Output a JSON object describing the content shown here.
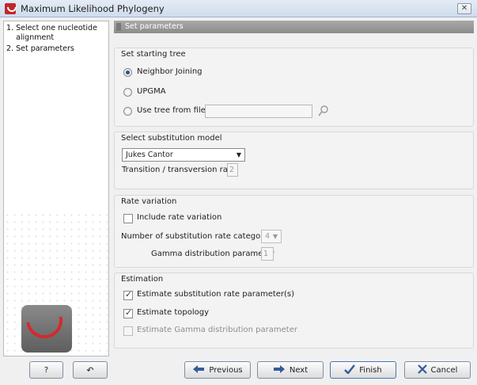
{
  "window": {
    "title": "Maximum Likelihood Phylogeny",
    "close_glyph": "✕"
  },
  "steps": [
    {
      "label": "1. Select one nucleotide\n    alignment"
    },
    {
      "label": "2. Set parameters"
    }
  ],
  "header": {
    "label": "Set parameters"
  },
  "starting_tree": {
    "title": "Set starting tree",
    "options": [
      {
        "label": "Neighbor Joining",
        "checked": true
      },
      {
        "label": "UPGMA",
        "checked": false
      },
      {
        "label": "Use tree from file",
        "checked": false
      }
    ],
    "file_value": ""
  },
  "substitution": {
    "title": "Select substitution model",
    "model": "Jukes Cantor",
    "ratio_label": "Transition / transversion ratio",
    "ratio_value": "2"
  },
  "rate_variation": {
    "title": "Rate variation",
    "include_label": "Include rate variation",
    "categories_label": "Number of substitution rate categories",
    "categories_value": "4",
    "gamma_label": "Gamma distribution parameter",
    "gamma_value": "1"
  },
  "estimation": {
    "title": "Estimation",
    "options": [
      {
        "label": "Estimate substitution rate parameter(s)",
        "checked": true,
        "enabled": true
      },
      {
        "label": "Estimate topology",
        "checked": true,
        "enabled": true
      },
      {
        "label": "Estimate Gamma distribution parameter",
        "checked": false,
        "enabled": false
      }
    ]
  },
  "buttons": {
    "help": "?",
    "reset_glyph": "↶",
    "previous": "Previous",
    "next": "Next",
    "finish": "Finish",
    "cancel": "Cancel"
  },
  "colors": {
    "accent": "#2d4f8f",
    "logo_red": "#d32a2e",
    "header_gray": "#9a9a9a"
  },
  "icons": {
    "app": "clc-logo-icon",
    "browse": "browse-file-icon",
    "previous": "arrow-left-icon",
    "next": "arrow-right-icon",
    "finish": "checkmark-icon",
    "cancel": "x-icon"
  }
}
